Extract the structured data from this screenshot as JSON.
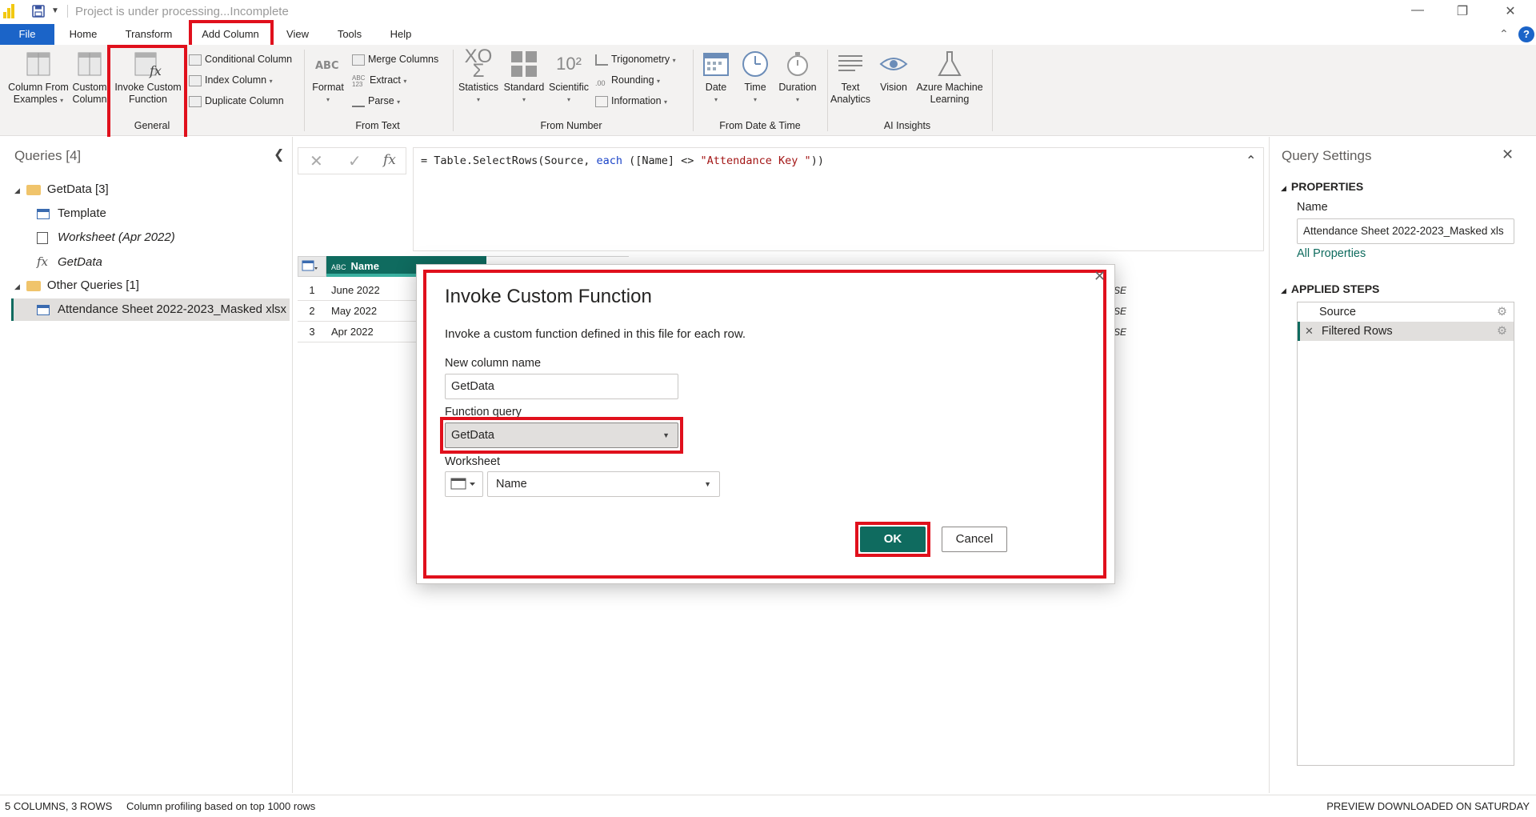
{
  "window": {
    "title": "Project is under processing...Incomplete",
    "controls": {
      "minimize": "—",
      "restore": "❐",
      "close": "✕"
    }
  },
  "tabs": [
    "File",
    "Home",
    "Transform",
    "Add Column",
    "View",
    "Tools",
    "Help"
  ],
  "ribbon": {
    "general": {
      "column_from_examples": "Column From Examples",
      "custom_column": "Custom Column",
      "invoke_custom_function": "Invoke Custom Function",
      "conditional_column": "Conditional Column",
      "index_column": "Index Column",
      "duplicate_column": "Duplicate Column",
      "group_label": "General"
    },
    "from_text": {
      "format": "Format",
      "merge_columns": "Merge Columns",
      "extract": "Extract",
      "parse": "Parse",
      "abc_icon": "ABC",
      "abc123_icon": "ABC 123",
      "group_label": "From Text"
    },
    "from_number": {
      "statistics": "Statistics",
      "standard": "Standard",
      "scientific": "Scientific",
      "trigonometry": "Trigonometry",
      "rounding": "Rounding",
      "information": "Information",
      "sci_icon": "10²",
      "round_icon": ".00",
      "group_label": "From Number"
    },
    "from_datetime": {
      "date": "Date",
      "time": "Time",
      "duration": "Duration",
      "group_label": "From Date & Time"
    },
    "ai": {
      "text_analytics": "Text Analytics",
      "vision": "Vision",
      "azure_ml": "Azure Machine Learning",
      "group_label": "AI Insights"
    }
  },
  "queries": {
    "header": "Queries [4]",
    "items": [
      {
        "label": "GetData [3]",
        "type": "folder"
      },
      {
        "label": "Template",
        "type": "table"
      },
      {
        "label": "Worksheet (Apr 2022)",
        "type": "sheet"
      },
      {
        "label": "GetData",
        "type": "function"
      },
      {
        "label": "Other Queries [1]",
        "type": "folder"
      },
      {
        "label": "Attendance Sheet 2022-2023_Masked xlsx",
        "type": "table"
      }
    ]
  },
  "formula": {
    "fx": "fx",
    "prefix": "= Table.SelectRows(Source, ",
    "keyword": "each",
    "middle": " ([Name] <> ",
    "string": "\"Attendance Key \"",
    "suffix": "))"
  },
  "grid": {
    "column_name": "Name",
    "type_icon": "ABC",
    "rows": [
      {
        "num": "1",
        "name": "June 2022"
      },
      {
        "num": "2",
        "name": "May 2022"
      },
      {
        "num": "3",
        "name": "Apr 2022"
      }
    ],
    "clipped_text": "SE"
  },
  "dialog": {
    "title": "Invoke Custom Function",
    "description": "Invoke a custom function defined in this file for each row.",
    "new_column_label": "New column name",
    "new_column_value": "GetData",
    "function_query_label": "Function query",
    "function_query_value": "GetData",
    "worksheet_label": "Worksheet",
    "worksheet_value": "Name",
    "ok": "OK",
    "cancel": "Cancel"
  },
  "settings": {
    "header": "Query Settings",
    "properties": "PROPERTIES",
    "name_label": "Name",
    "name_value": "Attendance Sheet 2022-2023_Masked xls",
    "all_properties": "All Properties",
    "applied_steps": "APPLIED STEPS",
    "steps": [
      "Source",
      "Filtered Rows"
    ]
  },
  "status": {
    "summary": "5 COLUMNS, 3 ROWS",
    "profiling": "Column profiling based on top 1000 rows",
    "preview": "PREVIEW DOWNLOADED ON SATURDAY"
  },
  "colors": {
    "accent": "#1b64c8",
    "teal": "#0f6b5f",
    "highlight_red": "#e0101c",
    "link": "#0e6b5e"
  }
}
